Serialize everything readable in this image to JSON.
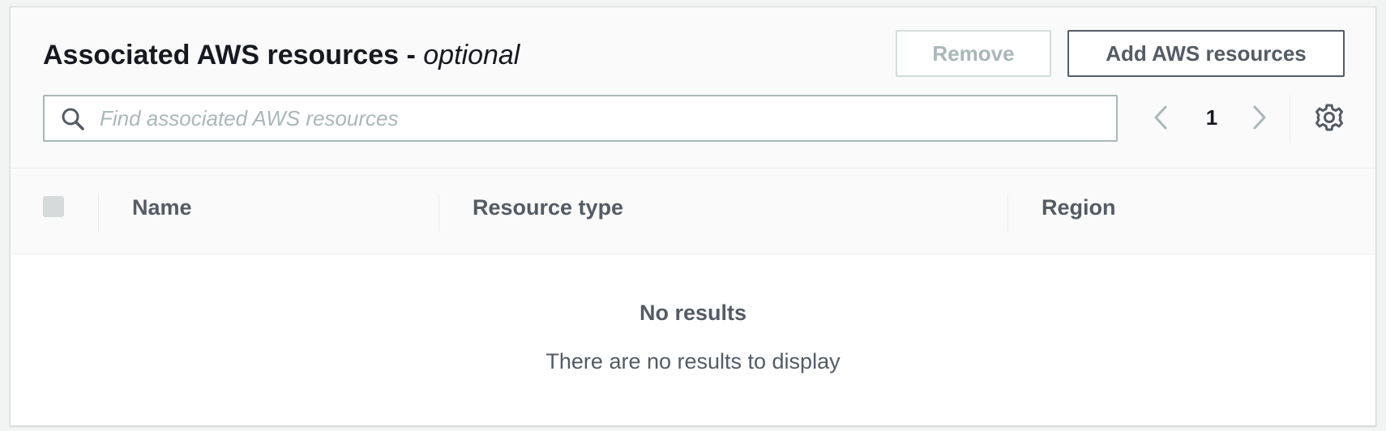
{
  "panel": {
    "title": "Associated AWS resources",
    "title_separator": "-",
    "title_suffix": "optional"
  },
  "actions": {
    "remove_label": "Remove",
    "add_label": "Add AWS resources"
  },
  "search": {
    "placeholder": "Find associated AWS resources",
    "value": ""
  },
  "pagination": {
    "current_page": "1"
  },
  "table": {
    "columns": [
      "Name",
      "Resource type",
      "Region"
    ],
    "rows": []
  },
  "empty_state": {
    "title": "No results",
    "description": "There are no results to display"
  },
  "icons": {
    "search": "search-icon",
    "prev": "chevron-left-icon",
    "next": "chevron-right-icon",
    "settings": "gear-icon"
  },
  "colors": {
    "text_primary": "#16191f",
    "text_secondary": "#545b64",
    "disabled": "#aab7b8",
    "border": "#d5dbdb"
  }
}
